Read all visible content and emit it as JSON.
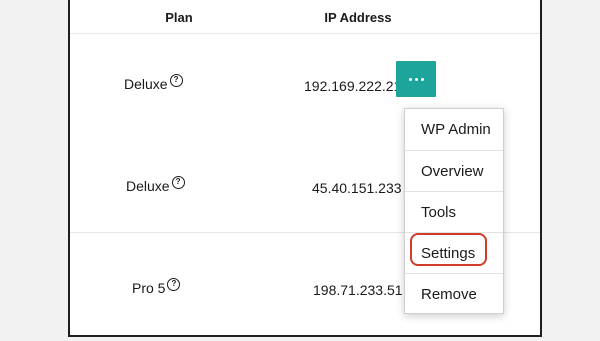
{
  "table": {
    "headers": {
      "plan": "Plan",
      "ip": "IP Address"
    },
    "rows": [
      {
        "plan": "Deluxe",
        "ip": "192.169.222.215"
      },
      {
        "plan": "Deluxe",
        "ip": "45.40.151.233"
      },
      {
        "plan": "Pro 5",
        "ip": "198.71.233.51"
      }
    ]
  },
  "actions_button": {
    "icon": "more-horizontal-icon"
  },
  "menu": {
    "items": [
      "WP Admin",
      "Overview",
      "Tools",
      "Settings",
      "Remove"
    ],
    "highlighted": "Settings"
  },
  "colors": {
    "accent": "#1ea59b",
    "highlight": "#d13b2a"
  },
  "icons": {
    "plan_help": "question-circle-icon"
  }
}
